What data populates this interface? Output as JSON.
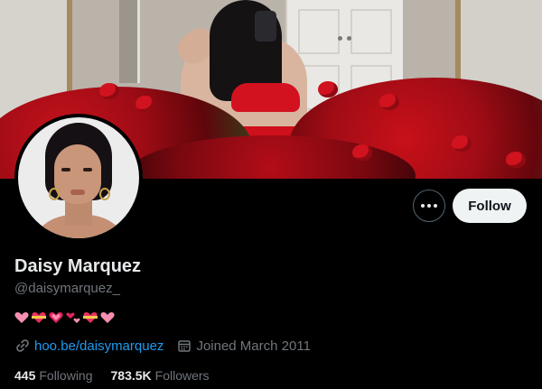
{
  "profile": {
    "name": "Daisy Marquez",
    "handle": "@daisymarquez_",
    "bio_emojis": [
      "pink-heart",
      "heart-with-ribbon",
      "growing-heart",
      "revolving-hearts",
      "heart-with-ribbon",
      "pink-heart"
    ],
    "website": "hoo.be/daisymarquez",
    "joined": "Joined March 2011"
  },
  "actions": {
    "more_icon": "more-horizontal-icon",
    "follow_label": "Follow"
  },
  "stats": {
    "following_count": "445",
    "following_label": "Following",
    "followers_count": "783.5K",
    "followers_label": "Followers"
  },
  "colors": {
    "background": "#000000",
    "text_primary": "#e7e9ea",
    "text_secondary": "#71767b",
    "link": "#1d9bf0",
    "follow_button_bg": "#eff3f4"
  }
}
